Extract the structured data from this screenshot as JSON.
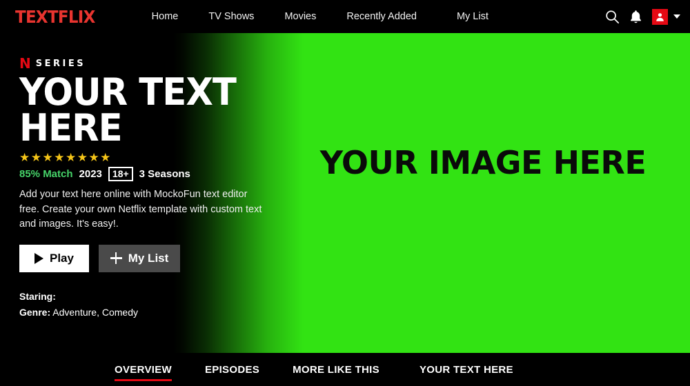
{
  "header": {
    "brand": "TEXTFLIX",
    "nav": [
      {
        "label": "Home"
      },
      {
        "label": "TV Shows"
      },
      {
        "label": "Movies"
      },
      {
        "label": "Recently Added"
      },
      {
        "label": "My List"
      }
    ],
    "icons": {
      "search": "search-icon",
      "notifications": "bell-icon",
      "avatar": "profile-avatar-icon",
      "caret": "chevron-down-icon"
    },
    "background_color": "#000000",
    "brand_color": "#e8342f"
  },
  "hero": {
    "badge": {
      "logo": "N",
      "label": "SERIES"
    },
    "title": "YOUR TEXT HERE",
    "stars": "★★★★★★★★",
    "star_count": 8,
    "meta": {
      "match": "85% Match",
      "year": "2023",
      "rating": "18+",
      "seasons": "3 Seasons"
    },
    "description": "Add your text here online with MockoFun text editor free. Create your own Netflix template with custom text and images. It's easy!.",
    "buttons": {
      "play": "Play",
      "my_list": "My List"
    },
    "credits": {
      "staring_label": "Staring:",
      "staring_value": "",
      "genre_label": "Genre:",
      "genre_value": "Adventure, Comedy"
    },
    "image_placeholder": "YOUR IMAGE HERE",
    "image_color": "#32e313",
    "match_color": "#46d369"
  },
  "tabs": {
    "items": [
      {
        "label": "OVERVIEW",
        "active": true
      },
      {
        "label": "EPISODES",
        "active": false
      },
      {
        "label": "MORE LIKE THIS",
        "active": false
      },
      {
        "label": "YOUR TEXT HERE",
        "active": false
      }
    ],
    "active_underline_color": "#e50914"
  }
}
